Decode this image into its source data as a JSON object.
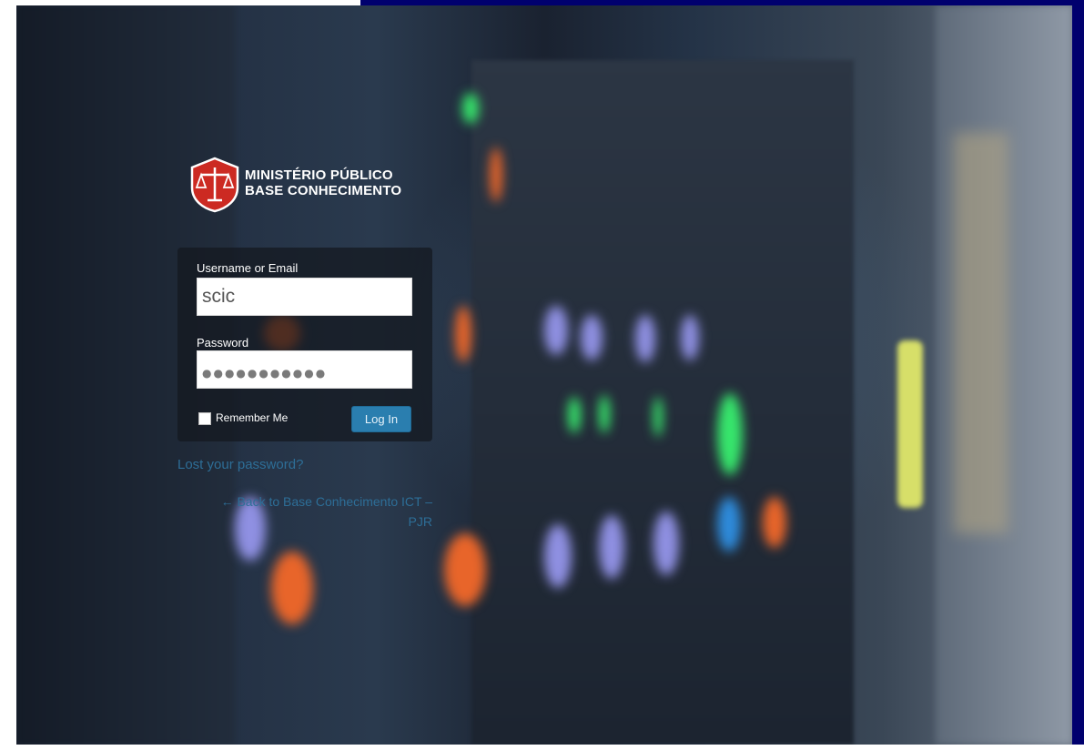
{
  "logo": {
    "line1": "MINISTÉRIO PÚBLICO",
    "line2": "BASE CONHECIMENTO",
    "icon": "scales-of-justice-icon"
  },
  "login": {
    "username_label": "Username or Email",
    "username_value": "scic",
    "password_label": "Password",
    "password_mask": "●●●●●●●●●●●",
    "remember_label": "Remember Me",
    "submit_label": "Log In"
  },
  "links": {
    "lost_password": "Lost your password?",
    "back_line1": "← Back to Base Conhecimento ICT –",
    "back_line2": "PJR"
  },
  "colors": {
    "outer_frame": "#00006e",
    "button": "#2a7eaf",
    "link": "#2d6e97",
    "logo_red": "#cc2a22"
  }
}
